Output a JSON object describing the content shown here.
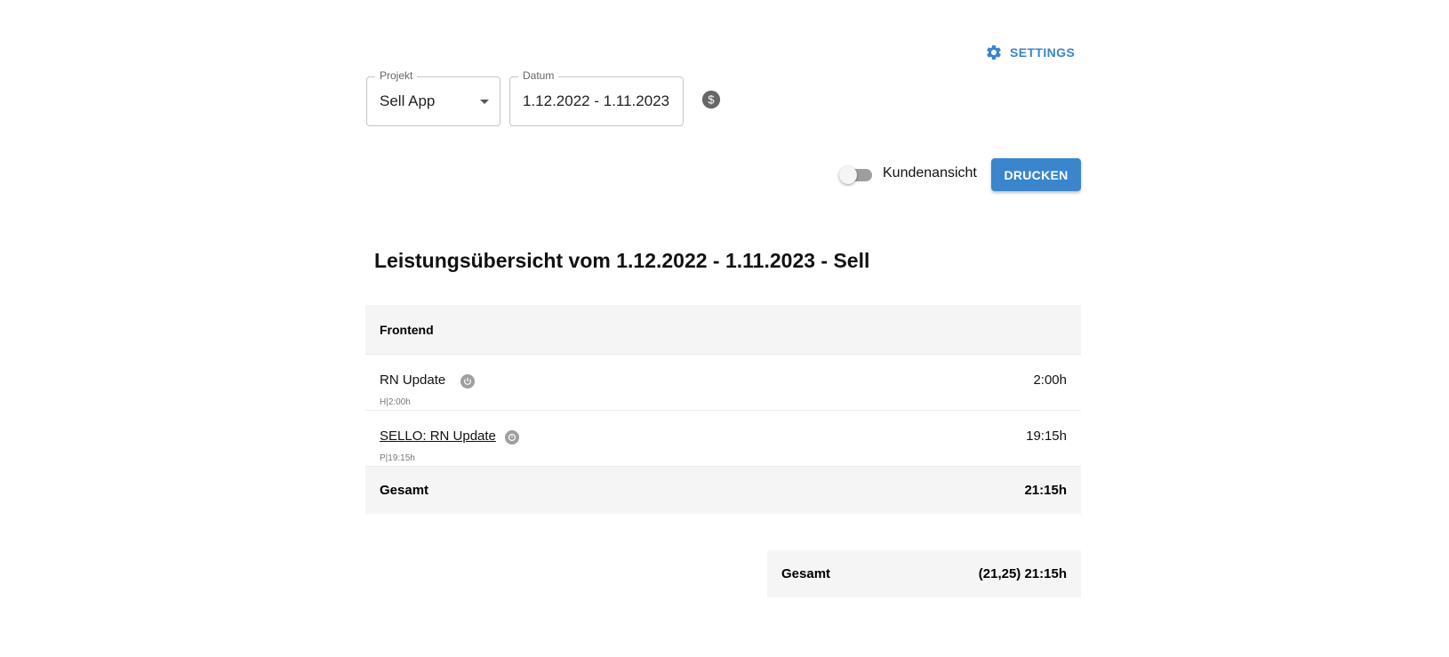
{
  "header": {
    "settings_label": "SETTINGS"
  },
  "filters": {
    "projekt": {
      "label": "Projekt",
      "value": "Sell App"
    },
    "datum": {
      "label": "Datum",
      "value": "1.12.2022 - 1.11.2023"
    }
  },
  "controls": {
    "customer_view_label": "Kundenansicht",
    "customer_view_on": false,
    "print_label": "DRUCKEN"
  },
  "report": {
    "title": "Leistungsübersicht vom 1.12.2022 - 1.11.2023 - Sell",
    "section": {
      "title": "Frontend",
      "items": [
        {
          "name": "RN Update",
          "sub": "H|2:00h",
          "hours": "2:00h",
          "is_link": false
        },
        {
          "name": "SELLO: RN Update",
          "sub": "P|19:15h",
          "hours": "19:15h",
          "is_link": true
        }
      ],
      "total_label": "Gesamt",
      "total_value": "21:15h"
    },
    "grand_total": {
      "label": "Gesamt",
      "value": "(21,25) 21:15h"
    }
  },
  "colors": {
    "accent": "#3a85cc",
    "row_background": "#f5f5f5"
  }
}
